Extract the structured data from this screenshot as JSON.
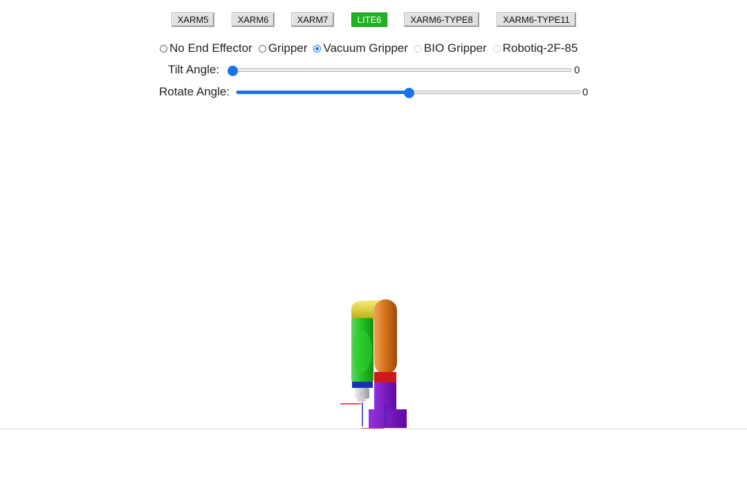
{
  "models": {
    "xarm5": "XARM5",
    "xarm6": "XARM6",
    "xarm7": "XARM7",
    "lite6": "LITE6",
    "type8": "XARM6-TYPE8",
    "type11": "XARM6-TYPE11",
    "selected": "LITE6"
  },
  "end_effectors": {
    "none": "No End Effector",
    "gripper": "Gripper",
    "vacuum": "Vacuum Gripper",
    "bio": "BIO Gripper",
    "robotiq": "Robotiq-2F-85",
    "selected": "Vacuum Gripper",
    "disabled": [
      "BIO Gripper",
      "Robotiq-2F-85"
    ]
  },
  "tilt": {
    "label": "Tilt Angle:",
    "value": "0",
    "fraction": 0.0
  },
  "rotate": {
    "label": "Rotate Angle:",
    "value": "0",
    "fraction": 0.5
  },
  "colors": {
    "selected_button": "#22b222",
    "slider": "#1a73e8",
    "link_yellow": "#d9c92a",
    "link_green": "#2eb82e",
    "link_orange": "#d6761c",
    "link_red": "#d01818",
    "link_purple": "#7a14c2",
    "link_blue": "#1a2fb8"
  }
}
